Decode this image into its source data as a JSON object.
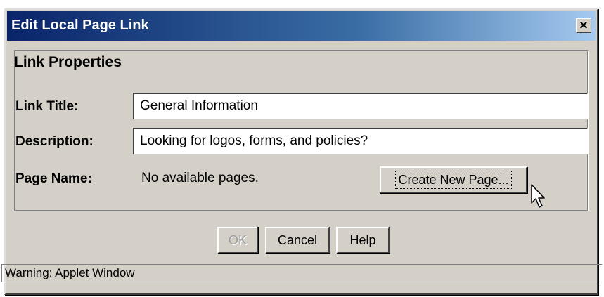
{
  "window": {
    "title": "Edit Local Page Link",
    "close_label": "×",
    "title_gradient": [
      "#0a246a",
      "#a6caf0"
    ]
  },
  "link_properties": {
    "heading": "Link Properties",
    "link_title_label": "Link Title:",
    "link_title_value": "General Information",
    "description_label": "Description:",
    "description_value": "Looking for logos, forms, and policies?",
    "page_name_label": "Page Name:",
    "page_name_value": "No available pages.",
    "create_page_label": "Create New Page..."
  },
  "buttons": {
    "ok": "OK",
    "cancel": "Cancel",
    "help": "Help"
  },
  "status": {
    "text": "Warning: Applet Window"
  },
  "icons": {
    "cursor": "arrow-cursor-icon",
    "close": "close-icon"
  }
}
